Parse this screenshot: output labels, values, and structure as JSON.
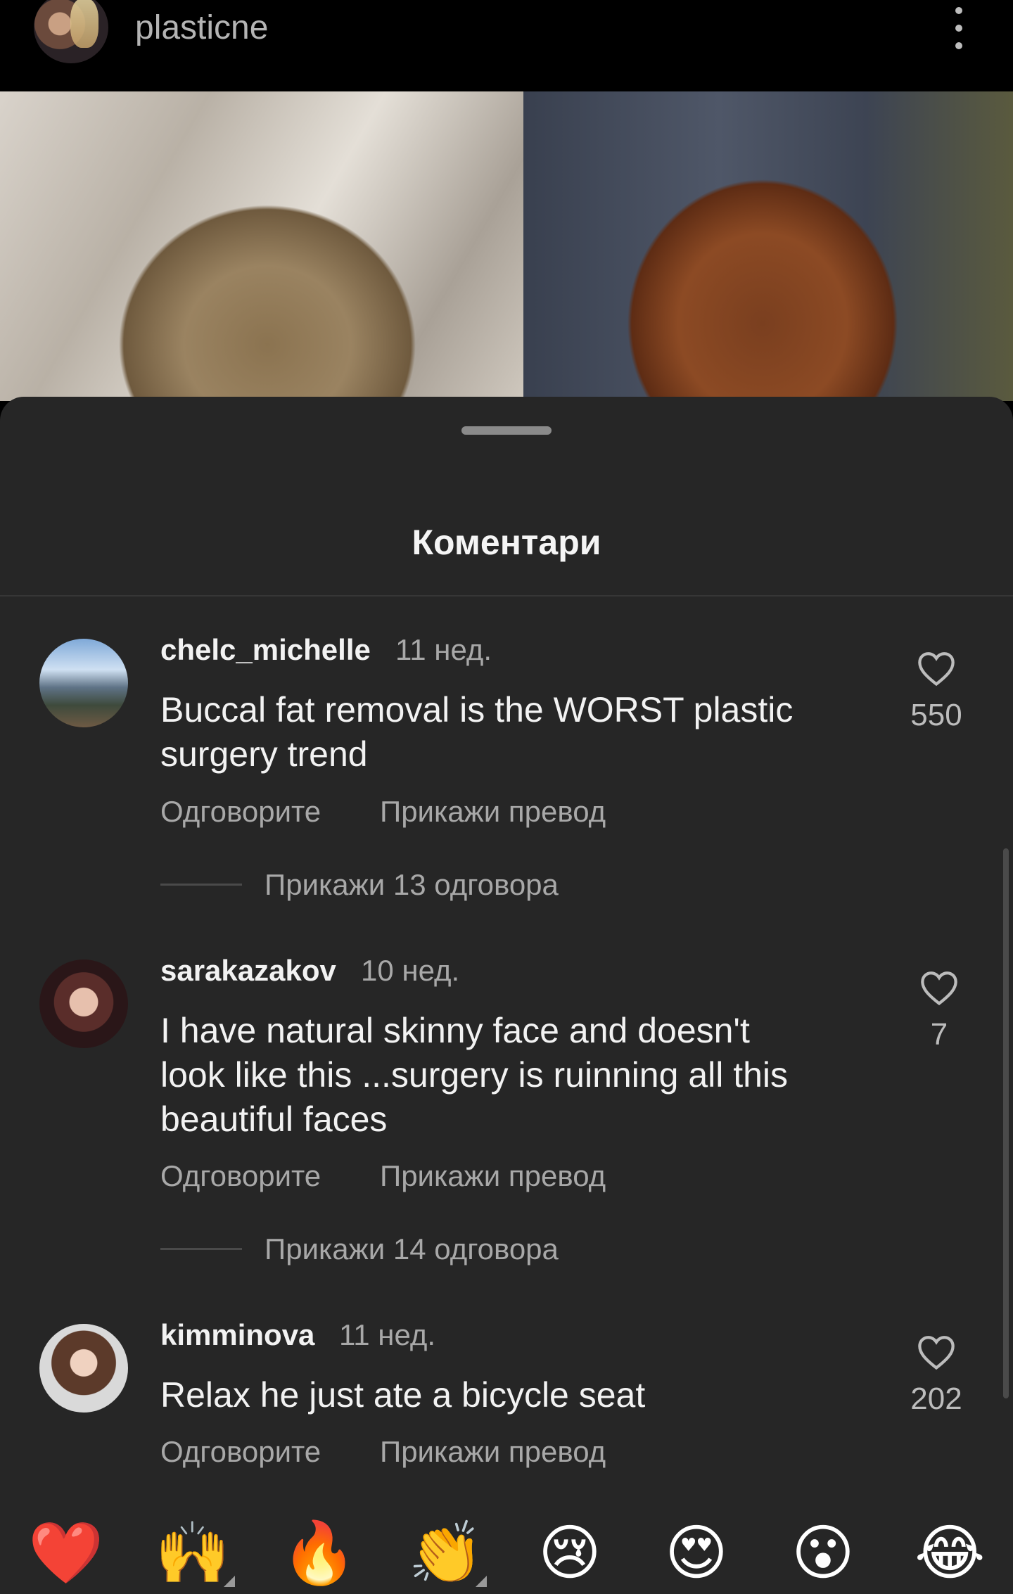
{
  "header": {
    "username": "plasticne"
  },
  "sheet": {
    "title": "Коментари"
  },
  "comments": [
    {
      "username": "chelc_michelle",
      "time": "11 нед.",
      "text_lines": [
        "Buccal fat removal is the WORST plastic",
        "surgery trend"
      ],
      "likes": "550",
      "reply_label": "Одговорите",
      "translate_label": "Прикажи превод",
      "view_replies": "Прикажи 13 одговора"
    },
    {
      "username": "sarakazakov",
      "time": "10 нед.",
      "text_lines": [
        "I have natural  skinny face and doesn't",
        "look like this ...surgery is ruinning all this",
        "beautiful faces"
      ],
      "likes": "7",
      "reply_label": "Одговорите",
      "translate_label": "Прикажи превод",
      "view_replies": "Прикажи 14 одговора"
    },
    {
      "username": "kimminova",
      "time": "11 нед.",
      "text_lines": [
        "Relax he just ate a bicycle seat"
      ],
      "likes": "202",
      "reply_label": "Одговорите",
      "translate_label": "Прикажи превод"
    }
  ],
  "emoji_bar": {
    "emojis": [
      "❤️",
      "🙌",
      "🔥",
      "👏",
      "😢",
      "😍",
      "😮",
      "😂"
    ]
  },
  "colors": {
    "sheet_bg": "#262626",
    "primary_text": "#f2f2f2",
    "secondary_text": "#a8a8a8"
  }
}
